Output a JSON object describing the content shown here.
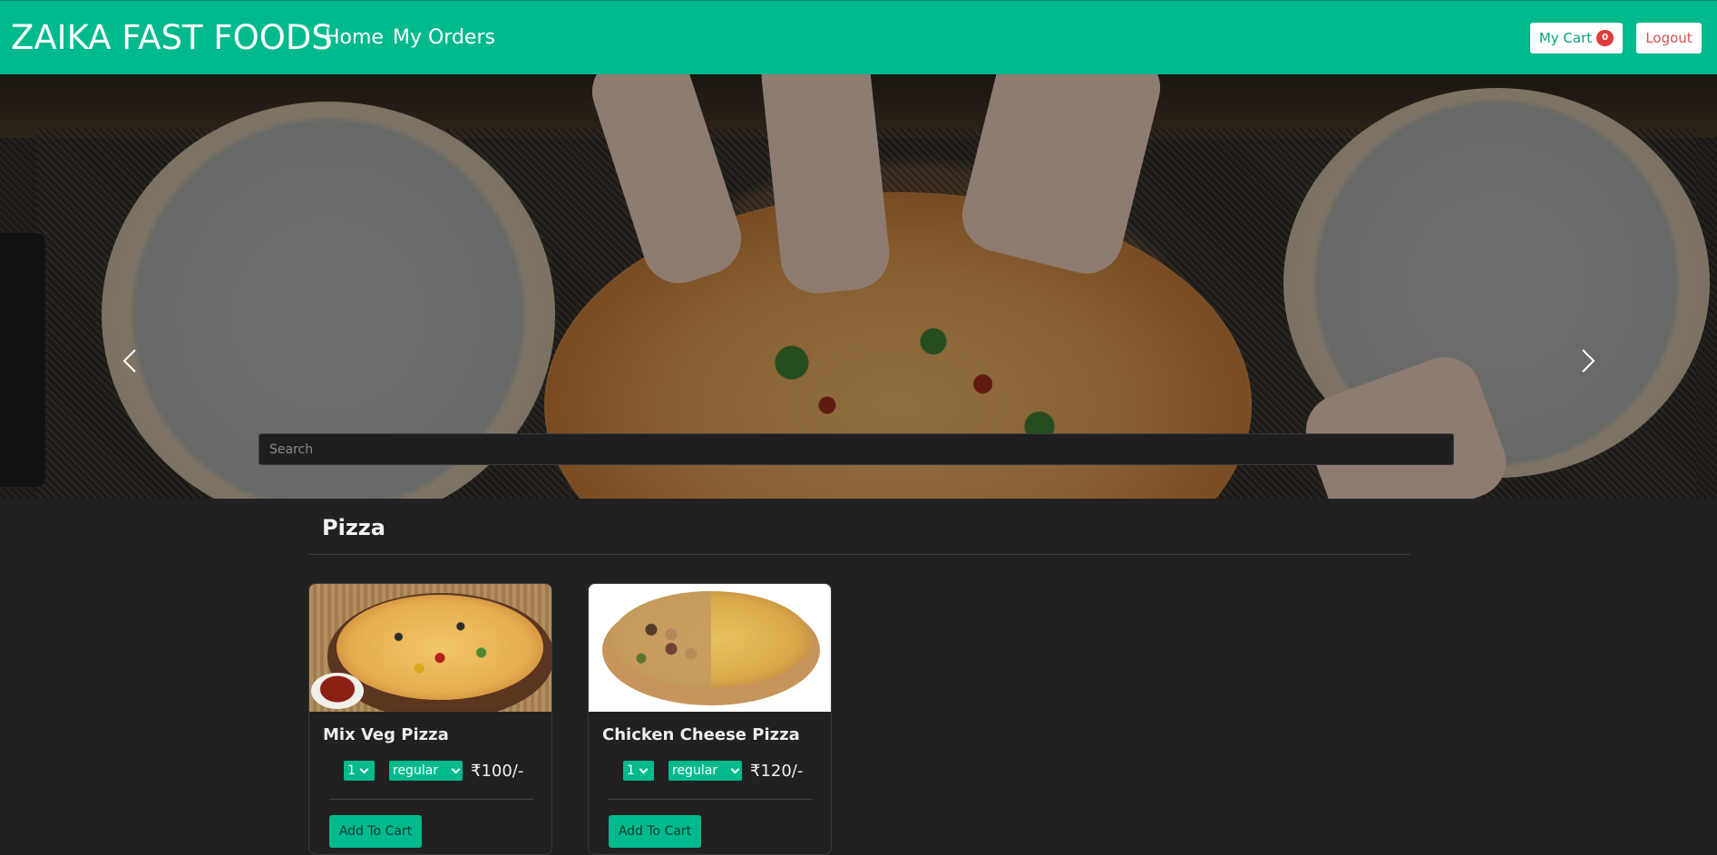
{
  "navbar": {
    "brand": "ZAIKA FAST FOODS",
    "links": [
      "Home",
      "My Orders"
    ],
    "cart_label": "My Cart",
    "cart_count": "0",
    "logout_label": "Logout"
  },
  "hero": {
    "search_placeholder": "Search"
  },
  "category": {
    "title": "Pizza"
  },
  "items": [
    {
      "name": "Mix Veg Pizza",
      "qty": "1",
      "size": "regular",
      "price": "₹100/-",
      "button": "Add To Cart"
    },
    {
      "name": "Chicken Cheese Pizza",
      "qty": "1",
      "size": "regular",
      "price": "₹120/-",
      "button": "Add To Cart"
    }
  ],
  "colors": {
    "primary": "#00b98c",
    "background": "#212121",
    "badge": "#e03b3b",
    "logout_text": "#dc4f4f"
  },
  "icons": {
    "carousel_prev": "chevron-left-icon",
    "carousel_next": "chevron-right-icon",
    "select_arrow": "chevron-down-icon"
  }
}
